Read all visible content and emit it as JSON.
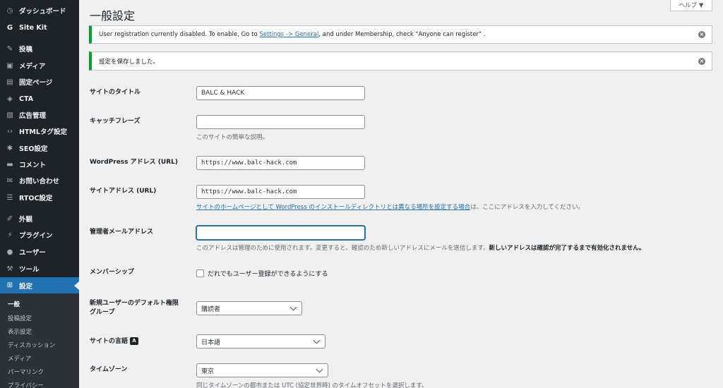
{
  "sidebar": {
    "items": [
      {
        "label": "ダッシュボード",
        "icon": "dashboard-icon",
        "glyph": "◷"
      },
      {
        "label": "Site Kit",
        "icon": "site-kit-icon",
        "glyph": "G"
      },
      {
        "label": "投稿",
        "icon": "posts-icon",
        "glyph": "✎"
      },
      {
        "label": "メディア",
        "icon": "media-icon",
        "glyph": "▣"
      },
      {
        "label": "固定ページ",
        "icon": "pages-icon",
        "glyph": "▤"
      },
      {
        "label": "CTA",
        "icon": "cta-icon",
        "glyph": "◈"
      },
      {
        "label": "広告管理",
        "icon": "ads-icon",
        "glyph": "▧"
      },
      {
        "label": "HTMLタグ設定",
        "icon": "code-icon",
        "glyph": "‹›"
      },
      {
        "label": "SEO設定",
        "icon": "seo-gear-icon",
        "glyph": "✱"
      },
      {
        "label": "コメント",
        "icon": "comments-icon",
        "glyph": "▬"
      },
      {
        "label": "お問い合わせ",
        "icon": "mail-icon",
        "glyph": "✉"
      },
      {
        "label": "RTOC設定",
        "icon": "list-icon",
        "glyph": "☰"
      },
      {
        "label": "外観",
        "icon": "appearance-icon",
        "glyph": "✐"
      },
      {
        "label": "プラグイン",
        "icon": "plugins-icon",
        "glyph": "⚡"
      },
      {
        "label": "ユーザー",
        "icon": "users-icon",
        "glyph": "●"
      },
      {
        "label": "ツール",
        "icon": "tools-icon",
        "glyph": "⚒"
      },
      {
        "label": "設定",
        "icon": "settings-icon",
        "glyph": "⊞"
      }
    ],
    "submenu": [
      "一般",
      "投稿設定",
      "表示設定",
      "ディスカッション",
      "メディア",
      "パーマリンク",
      "プライバシー"
    ]
  },
  "header": {
    "title": "一般設定",
    "help_label": "ヘルプ ▼"
  },
  "notices": {
    "registration_prefix": "User registration currently disabled. To enable, Go to ",
    "registration_link": "Settings -> General",
    "registration_suffix": ", and under Membership, check \"Anyone can register\" .",
    "saved": "設定を保存しました。"
  },
  "form": {
    "site_title_label": "サイトのタイトル",
    "site_title_value": "BALC & HACK",
    "tagline_label": "キャッチフレーズ",
    "tagline_value": "",
    "tagline_desc": "このサイトの簡単な説明。",
    "wp_address_label": "WordPress アドレス (URL)",
    "wp_address_value": "https://www.balc-hack.com",
    "site_address_label": "サイトアドレス (URL)",
    "site_address_value": "https://www.balc-hack.com",
    "site_address_desc_link": "サイトのホームページとして WordPress のインストールディレクトリとは異なる場所を設定する場合",
    "site_address_desc_suffix": "は、ここにアドレスを入力してください。",
    "admin_email_label": "管理者メールアドレス",
    "admin_email_value": "",
    "admin_email_desc": "このアドレスは管理のために使用されます。変更すると、確認のため新しいアドレスにメールを送信します。",
    "admin_email_desc_bold": "新しいアドレスは確認が完了するまで有効化されません。",
    "membership_label": "メンバーシップ",
    "membership_checkbox": "だれでもユーザー登録ができるようにする",
    "membership_checked": false,
    "default_role_label_1": "新規ユーザーのデフォルト権限",
    "default_role_label_2": "グループ",
    "default_role_value": "購読者",
    "language_label": "サイトの言語",
    "language_value": "日本語",
    "timezone_label": "タイムゾーン",
    "timezone_value": "東京",
    "timezone_desc": "同じタイムゾーンの都市または UTC (協定世界時) のタイムオフセットを選択します。"
  },
  "colors": {
    "sidebar_bg": "#1d2327",
    "accent": "#2271b1",
    "success": "#00a32a"
  }
}
